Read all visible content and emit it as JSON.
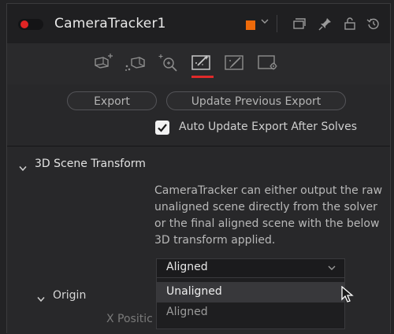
{
  "header": {
    "title": "CameraTracker1",
    "color_swatch": "#ee6a0a",
    "enabled_color": "#e02424"
  },
  "tabs": {
    "active_index": 3,
    "items": [
      {
        "name": "track-tab-icon"
      },
      {
        "name": "solve-tab-icon"
      },
      {
        "name": "refine-tab-icon"
      },
      {
        "name": "export-tab-icon"
      },
      {
        "name": "edit-tab-icon"
      },
      {
        "name": "options-tab-icon"
      }
    ]
  },
  "buttons": {
    "export_label": "Export",
    "update_label": "Update Previous Export"
  },
  "auto_update": {
    "checked": true,
    "label": "Auto Update Export After Solves"
  },
  "scene_transform": {
    "title": "3D Scene Transform",
    "description": "CameraTracker can either output the raw unaligned scene directly from the solver or the final aligned scene with the below 3D transform applied.",
    "dropdown": {
      "value": "Aligned",
      "options": [
        "Unaligned",
        "Aligned"
      ],
      "highlighted": "Unaligned"
    },
    "origin_label": "Origin",
    "x_position_label": "X Positic"
  }
}
